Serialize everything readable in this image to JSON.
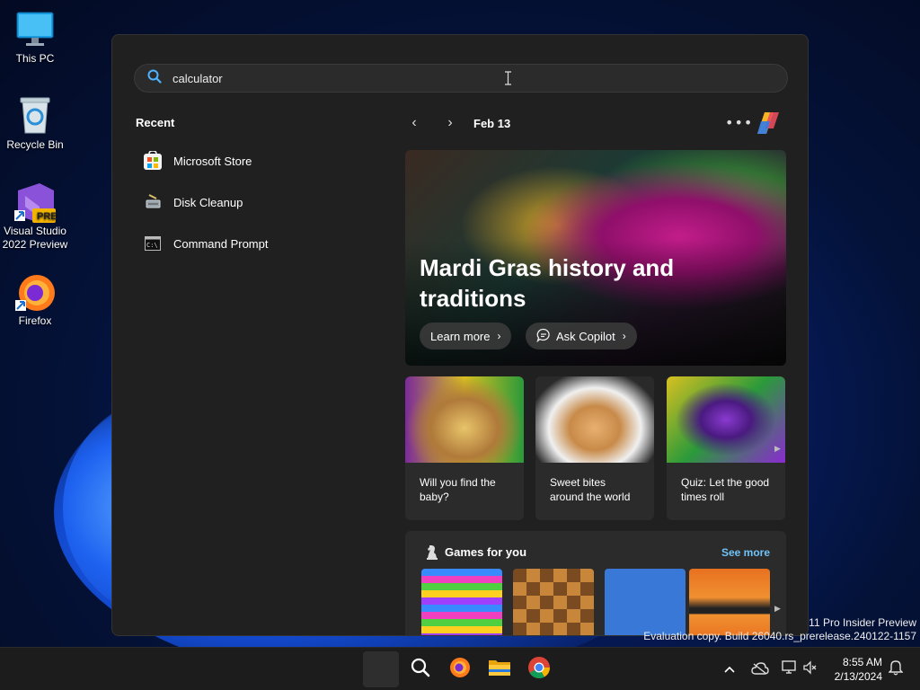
{
  "desktop": {
    "icons": [
      {
        "label": "This PC"
      },
      {
        "label": "Recycle Bin"
      },
      {
        "label": "Visual Studio 2022 Preview",
        "badge": "PRE"
      },
      {
        "label": "Firefox"
      }
    ]
  },
  "start": {
    "search": {
      "value": "calculator"
    },
    "recent": {
      "title": "Recent",
      "items": [
        {
          "label": "Microsoft Store",
          "icon": "store-icon"
        },
        {
          "label": "Disk Cleanup",
          "icon": "disk-cleanup-icon"
        },
        {
          "label": "Command Prompt",
          "icon": "cmd-icon"
        }
      ]
    },
    "nav": {
      "date": "Feb 13",
      "more": "•••"
    },
    "hero": {
      "title": "Mardi Gras history and traditions",
      "learn_more": "Learn more",
      "ask_copilot": "Ask Copilot"
    },
    "cards": [
      {
        "caption": "Will you find the baby?"
      },
      {
        "caption": "Sweet bites around the world"
      },
      {
        "caption": "Quiz: Let the good times roll"
      }
    ],
    "games": {
      "title": "Games for you",
      "see_more": "See more"
    }
  },
  "watermark": {
    "line1": "11 Pro Insider Preview",
    "line2": "Evaluation copy. Build 26040.rs_prerelease.240122-1157"
  },
  "taskbar": {
    "time": "8:55 AM",
    "date": "2/13/2024"
  },
  "colors": {
    "accent_link": "#6fc3f7",
    "panel_bg": "#202020",
    "card_bg": "#2b2b2b"
  }
}
